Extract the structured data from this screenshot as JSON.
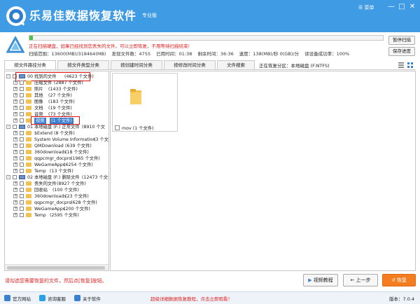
{
  "app": {
    "title": "乐易佳数据恢复软件",
    "edition": "专业版",
    "menu_label": "菜单",
    "win_min": "—",
    "win_max": "□",
    "win_close": "✕"
  },
  "scan": {
    "progress": 0.01,
    "message": "正在扫描硬盘，如果已经找到您丢失的文件，可以立即恢复，不用等待扫描结束!",
    "range": "扫描范围：13600(MB)/318464(MB)",
    "found": "发现文件数：4755",
    "elapsed": "已用时间：01:38",
    "remaining": "剩余时间：36:36",
    "speed": "速度：138(MB)/秒 0(GB)/分",
    "success_rate": "读设备成功率：100%"
  },
  "actions": {
    "pause": "暂停扫描",
    "save": "保存进度"
  },
  "tabs": [
    {
      "label": "按文件路径分类"
    },
    {
      "label": "按文件类型分类"
    },
    {
      "label": "按创建时间分类"
    },
    {
      "label": "按修改时间分类"
    },
    {
      "label": "文件搜索"
    }
  ],
  "partition_label": "正在恢复分区：本地磁盘 (F:NTFS)",
  "tree": [
    {
      "label": "00 找到的文件",
      "count": "(4623 个文件)"
    },
    {
      "label": "压缩文件",
      "count": "(2887 个文件)"
    },
    {
      "label": "照片",
      "count": "(1433 个文件)"
    },
    {
      "label": "其他",
      "count": "(27 个文件)"
    },
    {
      "label": "图像",
      "count": "(183 个文件)"
    },
    {
      "label": "文档",
      "count": "(19 个文件)"
    },
    {
      "label": "音频",
      "count": "(73 个文件)"
    },
    {
      "label": "视频",
      "count": "(1 个文件)"
    },
    {
      "label": "01 本地磁盘 (F:) 正常文件",
      "count": "(8910 个文"
    },
    {
      "label": "$Extend",
      "count": "(8 个文件)"
    },
    {
      "label": "System Volume Information",
      "count": "(3 个文"
    },
    {
      "label": "QMDownload",
      "count": "(639 个文件)"
    },
    {
      "label": "360downloads",
      "count": "(18 个文件)"
    },
    {
      "label": "qqpcmgr_docpro",
      "count": "(1965 个文件)"
    },
    {
      "label": "WeGameApps",
      "count": "(6254 个文件)"
    },
    {
      "label": "Temp",
      "count": "(13 个文件)"
    },
    {
      "label": "02 本地磁盘 (F:) 删除文件",
      "count": "(12473 个文件"
    },
    {
      "label": "丢失的文件",
      "count": "(8927 个文件)"
    },
    {
      "label": "回收站",
      "count": "(100 个文件)"
    },
    {
      "label": "360downloads",
      "count": "(23 个文件)"
    },
    {
      "label": "qqpcmgr_docpro",
      "count": "(628 个文件)"
    },
    {
      "label": "WeGameApps",
      "count": "(200 个文件)"
    },
    {
      "label": "Temp",
      "count": "(2595 个文件)"
    }
  ],
  "file_item": {
    "label": "mov",
    "count": "(1 个文件)"
  },
  "hint": "请勾选您需要恢复的文件，然后点[恢复]按钮。",
  "bottom": {
    "video": "视频教程",
    "prev": "上一步",
    "restore": "恢复"
  },
  "footer": {
    "site": "官方网站",
    "support": "咨询客服",
    "about": "关于软件",
    "promo": "超级详细数据恢复教程，点击立即观看！",
    "version": "版本：7.0.4"
  },
  "colors": {
    "titlebar": "#3f9be3",
    "progress": "#4cbf4c",
    "warning": "#e02020",
    "restore": "#f47d20"
  }
}
